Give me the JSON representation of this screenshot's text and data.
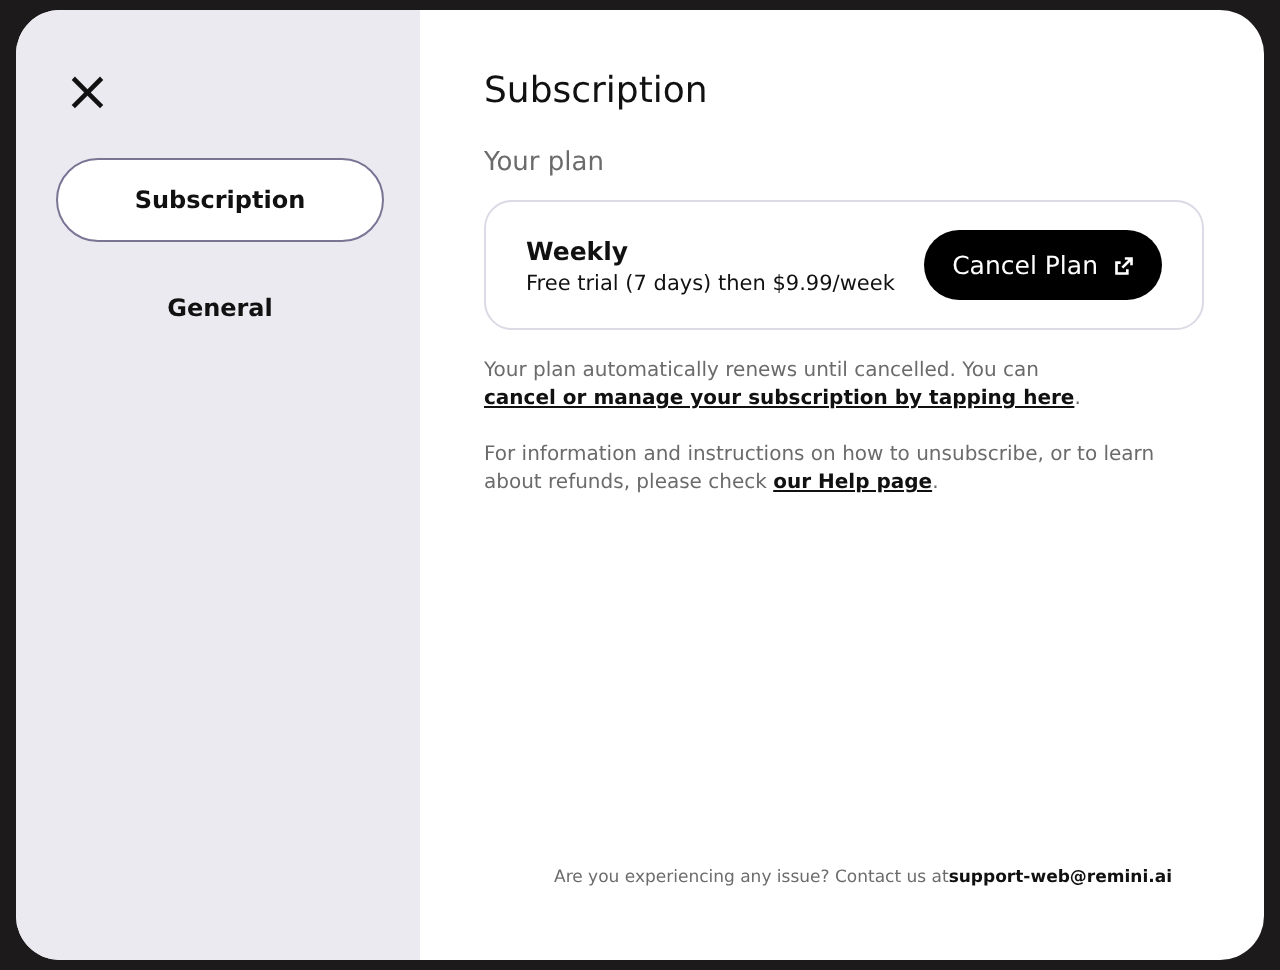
{
  "close": {
    "label": "×"
  },
  "sidebar": {
    "items": [
      {
        "label": "Subscription",
        "selected": true
      },
      {
        "label": "General",
        "selected": false
      }
    ]
  },
  "main": {
    "title": "Subscription",
    "section": "Your plan",
    "plan": {
      "name": "Weekly",
      "details": "Free trial (7 days) then $9.99/week",
      "button": "Cancel Plan"
    },
    "paragraphs": [
      [
        {
          "kind": "text",
          "text": "Your plan automatically renews until cancelled. You can "
        },
        {
          "kind": "link",
          "text": "cancel or manage your subscription by tapping here"
        },
        {
          "kind": "text",
          "text": "."
        }
      ],
      [
        {
          "kind": "text",
          "text": "For information and instructions on how to unsubscribe, or to learn about refunds, please check "
        },
        {
          "kind": "link",
          "text": "our Help page"
        },
        {
          "kind": "text",
          "text": "."
        }
      ]
    ],
    "footer": "Are you experiencing any issue? Contact us at**support-web@remini.ai**"
  }
}
